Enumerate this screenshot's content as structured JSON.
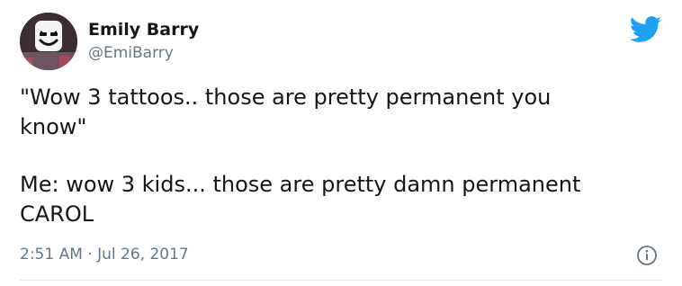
{
  "author": {
    "display_name": "Emily Barry",
    "handle": "@EmiBarry",
    "avatar_icon": "marshmello-helmet-avatar"
  },
  "brand": {
    "logo_icon": "twitter-bird-icon",
    "color": "#1da1f2"
  },
  "tweet": {
    "paragraph_1": "\"Wow 3 tattoos.. those are pretty permanent you\nknow\"",
    "paragraph_2": "Me: wow 3 kids... those are pretty damn permanent\nCAROL"
  },
  "meta": {
    "timestamp": "2:51 AM · Jul 26, 2017",
    "info_icon": "info-icon"
  },
  "colors": {
    "text": "#14171a",
    "muted": "#657786",
    "divider": "#e1e8ed"
  }
}
